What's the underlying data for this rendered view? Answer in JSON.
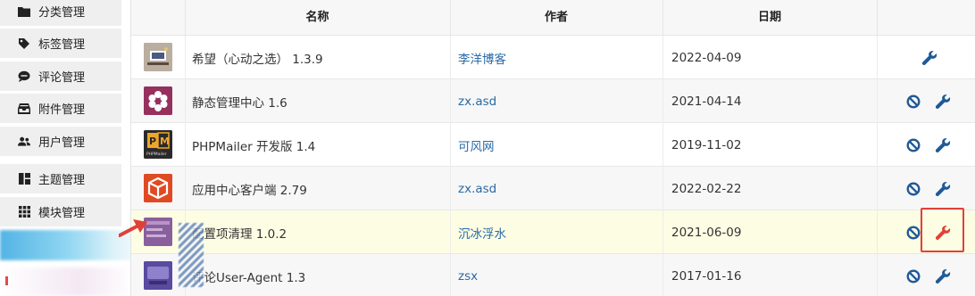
{
  "sidebar": {
    "items": [
      {
        "label": "分类管理",
        "icon": "folder-icon"
      },
      {
        "label": "标签管理",
        "icon": "tag-icon"
      },
      {
        "label": "评论管理",
        "icon": "comment-icon"
      },
      {
        "label": "附件管理",
        "icon": "inbox-icon"
      },
      {
        "label": "用户管理",
        "icon": "users-icon"
      },
      {
        "label": "主题管理",
        "icon": "theme-icon"
      },
      {
        "label": "模块管理",
        "icon": "grid-icon"
      }
    ]
  },
  "table": {
    "headers": {
      "name": "名称",
      "author": "作者",
      "date": "日期"
    },
    "rows": [
      {
        "name": "希望（心动之选） 1.3.9",
        "author": "李洋博客",
        "date": "2022-04-09",
        "thumb": "thumb-desk-icon",
        "disable": false
      },
      {
        "name": "静态管理中心 1.6",
        "author": "zx.asd",
        "date": "2021-04-14",
        "thumb": "thumb-hexagon-icon",
        "disable": true
      },
      {
        "name": "PHPMailer 开发版 1.4",
        "author": "可风网",
        "date": "2019-11-02",
        "thumb": "thumb-phpmailer-icon",
        "disable": true
      },
      {
        "name": "应用中心客户端 2.79",
        "author": "zx.asd",
        "date": "2022-02-22",
        "thumb": "thumb-box-icon",
        "disable": true
      },
      {
        "name": "配置项清理 1.0.2",
        "author": "沉冰浮水",
        "date": "2021-06-09",
        "thumb": "thumb-config-icon",
        "disable": true,
        "highlight": true
      },
      {
        "name": "评论User-Agent 1.3",
        "author": "zsx",
        "date": "2017-01-16",
        "thumb": "thumb-ua-icon",
        "disable": true
      }
    ]
  },
  "thumb_texts": {
    "phpmailer": "PHPMailer"
  },
  "colors": {
    "link": "#2a6aa6",
    "action": "#1f5a96",
    "alert": "#e0403a",
    "highlight_row": "#fdfde4"
  }
}
